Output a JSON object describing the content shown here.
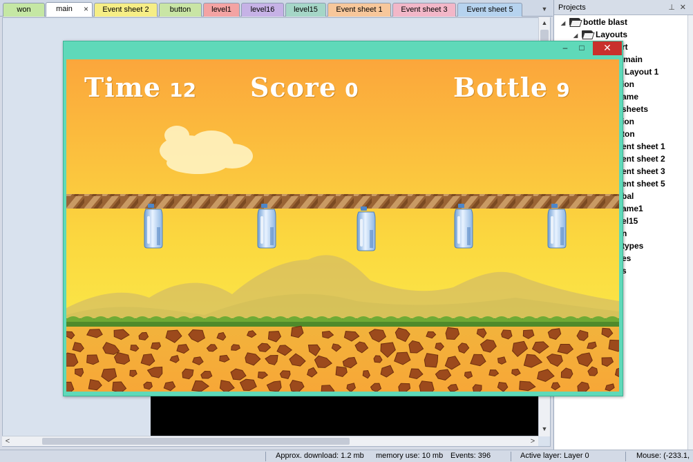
{
  "tabs": [
    {
      "label": "won",
      "color": "#c5e7a4",
      "active": false
    },
    {
      "label": "main",
      "color": "#ffffff",
      "active": true,
      "closable": true
    },
    {
      "label": "Event sheet 2",
      "color": "#f6ee86",
      "active": false
    },
    {
      "label": "button",
      "color": "#c9e5a5",
      "active": false
    },
    {
      "label": "level1",
      "color": "#f3a3a3",
      "active": false
    },
    {
      "label": "level16",
      "color": "#c6b2e6",
      "active": false
    },
    {
      "label": "level15",
      "color": "#a5d6c7",
      "active": false
    },
    {
      "label": "Event sheet 1",
      "color": "#f7c79b",
      "active": false
    },
    {
      "label": "Event sheet 3",
      "color": "#f2b7c8",
      "active": false
    },
    {
      "label": "Event sheet 5",
      "color": "#b6d3ef",
      "active": false
    }
  ],
  "tab_close_glyph": "×",
  "tab_dropdown_glyph": "▼",
  "projects": {
    "header": "Projects",
    "pin_glyph": "⊥",
    "hide_glyph": "✕",
    "tree": [
      {
        "label": "bottle blast",
        "type": "folder",
        "expanded": true
      },
      {
        "label": "Layouts",
        "type": "folder",
        "expanded": true
      },
      {
        "label": "rt"
      },
      {
        "label": "main"
      },
      {
        "label": "Layout 1"
      },
      {
        "label": "ion"
      },
      {
        "label": "ame"
      },
      {
        "label": "sheets"
      },
      {
        "label": "ion"
      },
      {
        "label": "ton"
      },
      {
        "label": "ent sheet 1"
      },
      {
        "label": "ent sheet 2"
      },
      {
        "label": "ent sheet 3"
      },
      {
        "label": "ent sheet 5"
      },
      {
        "label": "bal"
      },
      {
        "label": "ame1"
      },
      {
        "label": "el15"
      },
      {
        "label": "n"
      },
      {
        "label": " types"
      },
      {
        "label": "es"
      },
      {
        "label": "s"
      }
    ]
  },
  "game": {
    "window_controls": {
      "minimize": "–",
      "maximize": "□",
      "close": "✕"
    },
    "hud": {
      "time_label": "Time",
      "time_value": "12",
      "score_label": "Score",
      "score_value": "0",
      "bottle_label": "Bottle",
      "bottle_value": "9"
    },
    "bottle_count_visible": 5,
    "colors": {
      "window": "#5fd9b9",
      "close": "#c9302c",
      "sky_top": "#fba63c",
      "sky_bottom": "#fbf04a"
    }
  },
  "scrollbar": {
    "up": "▲",
    "down": "▼",
    "left": "<",
    "right": ">"
  },
  "status": {
    "download": "Approx. download: 1.2 mb",
    "memory": "memory use: 10 mb",
    "events": "Events: 396",
    "layer": "Active layer: Layer 0",
    "mouse": "Mouse: (-233.1,"
  }
}
